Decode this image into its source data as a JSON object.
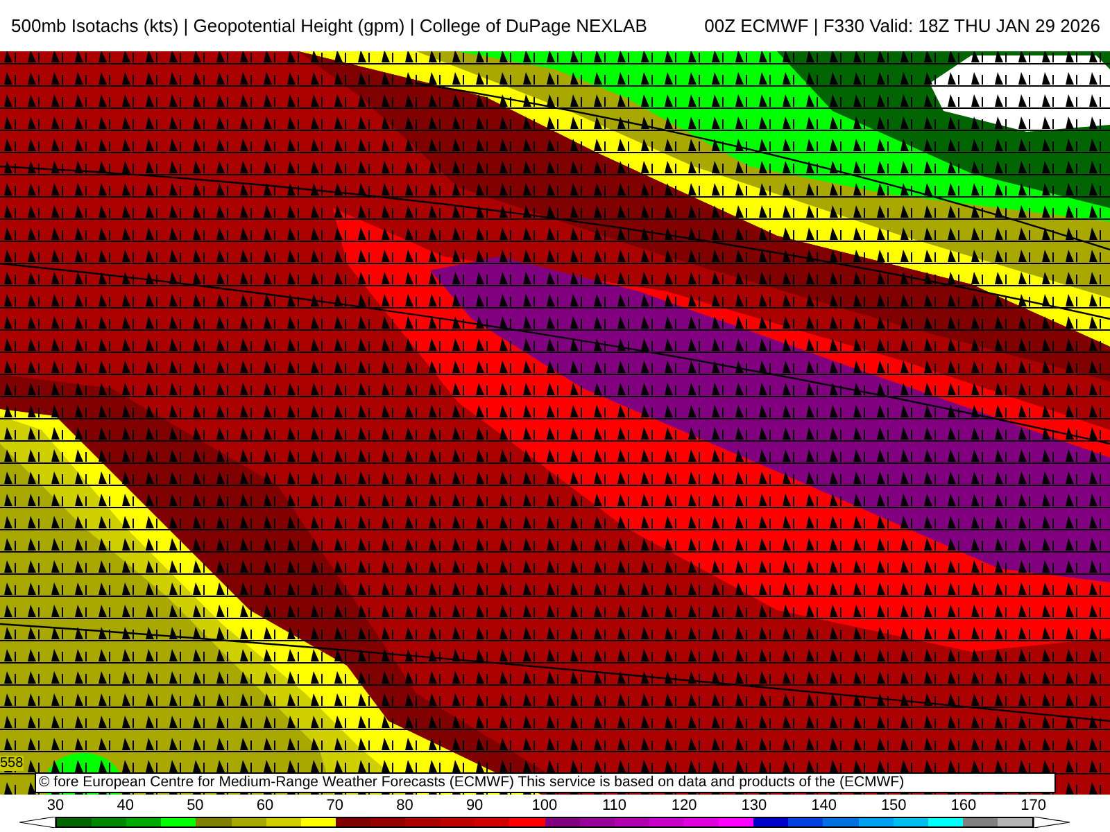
{
  "header": {
    "title": "500mb Isotachs (kts) | Geopotential Height (gpm) | College of DuPage NEXLAB",
    "run": "00Z ECMWF | F330 Valid: 18Z THU JAN 29 2026"
  },
  "map": {
    "contour_label": "558"
  },
  "credit": "© fore European Centre for Medium-Range Weather Forecasts (ECMWF)  This service is based on data and products of the (ECMWF)",
  "legend": {
    "labels": [
      "30",
      "40",
      "50",
      "60",
      "70",
      "80",
      "90",
      "100",
      "110",
      "120",
      "130",
      "140",
      "150",
      "160",
      "170"
    ],
    "bins": [
      {
        "color": "#006400"
      },
      {
        "color": "#008800"
      },
      {
        "color": "#00aa00"
      },
      {
        "color": "#00ff00"
      },
      {
        "color": "#808000"
      },
      {
        "color": "#a8a800"
      },
      {
        "color": "#d0d000"
      },
      {
        "color": "#ffff00"
      },
      {
        "color": "#800000"
      },
      {
        "color": "#960000"
      },
      {
        "color": "#aa0000"
      },
      {
        "color": "#be0000"
      },
      {
        "color": "#d20000"
      },
      {
        "color": "#ff0000"
      },
      {
        "color": "#800080"
      },
      {
        "color": "#990099"
      },
      {
        "color": "#b000b0"
      },
      {
        "color": "#c800c8"
      },
      {
        "color": "#e000e0"
      },
      {
        "color": "#ff00ff"
      },
      {
        "color": "#0000cd"
      },
      {
        "color": "#0040e0"
      },
      {
        "color": "#0070e0"
      },
      {
        "color": "#00a0f0"
      },
      {
        "color": "#00c0f0"
      },
      {
        "color": "#00ffff"
      },
      {
        "color": "#808080"
      },
      {
        "color": "#b4b4b4"
      }
    ]
  }
}
